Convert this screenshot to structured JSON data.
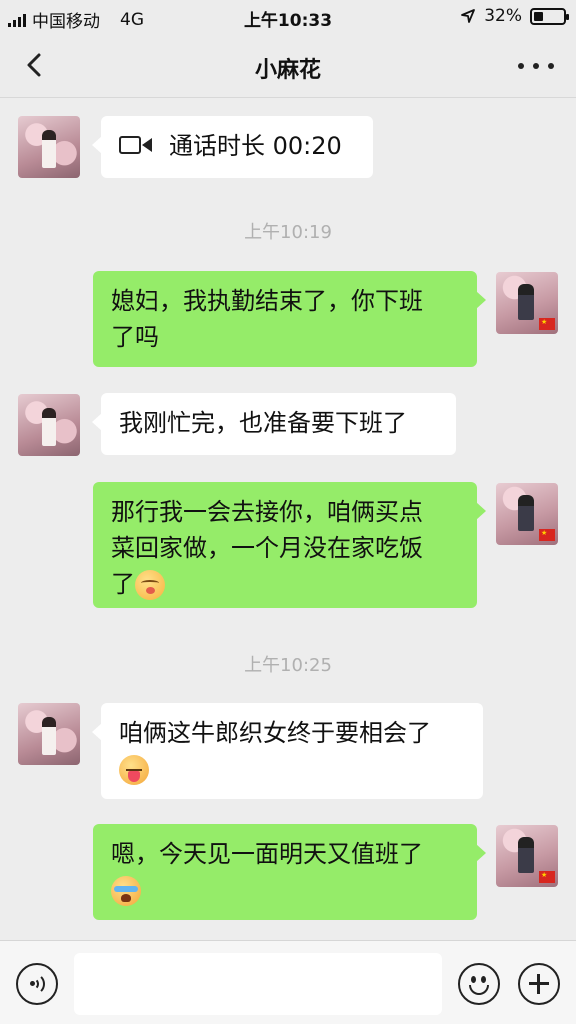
{
  "status_bar": {
    "carrier": "中国移动",
    "network": "4G",
    "time": "上午10:33",
    "battery": "32%",
    "battery_level": 0.32
  },
  "header": {
    "title": "小麻花",
    "back_icon": "chevron-left-icon",
    "more_icon": "more-dots-icon"
  },
  "chat": {
    "call": {
      "text": "通话时长 00:20",
      "icon": "video-call-icon"
    },
    "timestamp_1": "上午10:19",
    "msg_1": "媳妇，我执勤结束了，你下班",
    "msg_1_line2": "了吗",
    "msg_2": "我刚忙完，也准备要下班了",
    "msg_3_line1": "那行我一会去接你，咱俩买点",
    "msg_3_line2": "菜回家做，一个月没在家吃饭",
    "msg_3_line3": "了",
    "timestamp_2": "上午10:25",
    "msg_4_line1": "咱俩这牛郎织女终于要相会了",
    "msg_5_line1": "嗯，今天见一面明天又值班了"
  },
  "input_bar": {
    "placeholder": "",
    "voice_icon": "voice-icon",
    "emoji_icon": "emoji-icon",
    "plus_icon": "plus-icon"
  },
  "colors": {
    "outgoing_bubble": "#95ec69",
    "incoming_bubble": "#ffffff",
    "background": "#ededed"
  }
}
